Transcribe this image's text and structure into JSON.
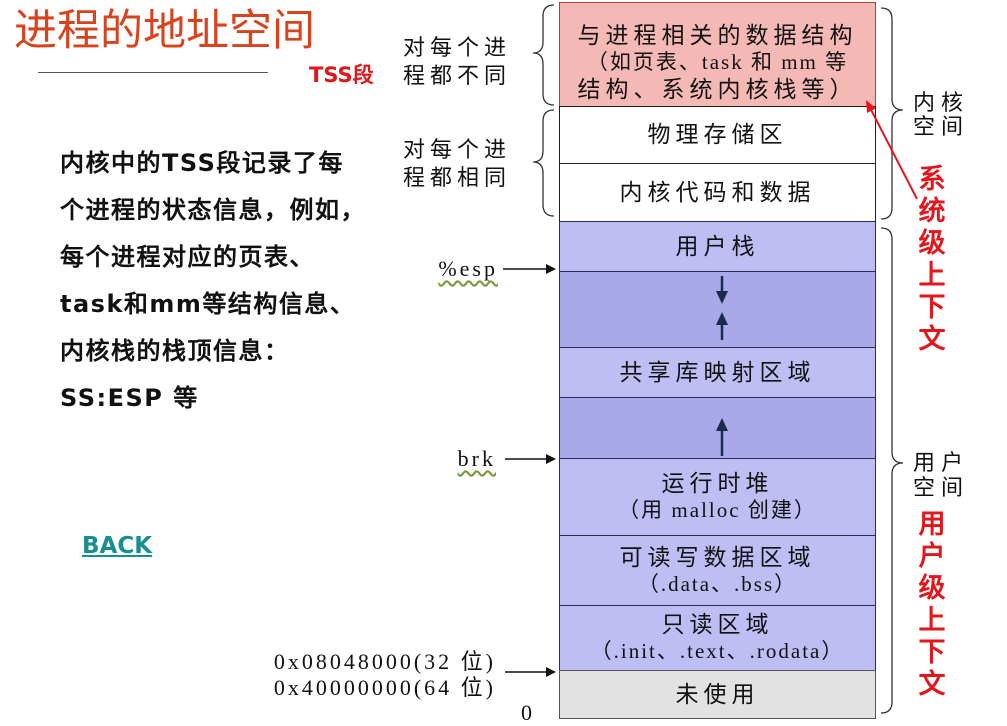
{
  "title": "进程的地址空间",
  "tss_label": "TSS段",
  "description": {
    "lines": [
      "内核中的TSS段记录了每",
      "个进程的状态信息，例如，",
      "每个进程对应的页表、",
      "task和mm等结构信息、",
      "内核栈的栈顶信息：",
      "SS:ESP 等"
    ]
  },
  "back_link": {
    "label": "BACK"
  },
  "notes": {
    "per_process_different": [
      "对每个进",
      "程都不同"
    ],
    "per_process_same": [
      "对每个进",
      "程都相同"
    ]
  },
  "pointers": {
    "stack_pointer": "%esp",
    "heap_break": "brk",
    "text_start_32": "0x08048000(32 位)",
    "text_start_64": "0x40000000(64 位)",
    "bottom": "0"
  },
  "memory_map": {
    "kernel": {
      "space_label": [
        "内核",
        "空间"
      ],
      "context_label": "系统级上下文",
      "regions": [
        {
          "lines": [
            "与进程相关的数据结构",
            "（如页表、task 和 mm 等",
            "结构、系统内核栈等）"
          ]
        },
        {
          "lines": [
            "物理存储区"
          ]
        },
        {
          "lines": [
            "内核代码和数据"
          ]
        }
      ]
    },
    "user": {
      "space_label": [
        "用户",
        "空间"
      ],
      "context_label": "用户级上下文",
      "regions": [
        {
          "lines": [
            "用户栈"
          ]
        },
        {
          "lines": [
            "共享库映射区域"
          ]
        },
        {
          "lines": [
            "运行时堆",
            "（用 malloc 创建）"
          ]
        },
        {
          "lines": [
            "可读写数据区域",
            "（.data、.bss）"
          ]
        },
        {
          "lines": [
            "只读区域",
            "（.init、.text、.rodata）"
          ]
        },
        {
          "lines": [
            "未使用"
          ]
        }
      ]
    }
  },
  "icons": {
    "stack_growth": "arrow-down-icon",
    "mmap_growth": "arrow-up-icon",
    "heap_growth": "arrow-up-icon",
    "pointer": "arrow-right-icon",
    "context_pointer": "red-arrow-icon",
    "group_brace": "brace-icon"
  },
  "colors": {
    "title": "#D8431E",
    "emphasis_red": "#E3161B",
    "link": "#178F8F",
    "kernel_data_fill": "#F5B9B5",
    "kernel_fill": "#FFFFFF",
    "user_region_fill": "#BEBEF4",
    "user_gap_fill": "#A9A9E9",
    "unused_fill": "#E2E2E2",
    "arrow": "#1C2B4A"
  }
}
